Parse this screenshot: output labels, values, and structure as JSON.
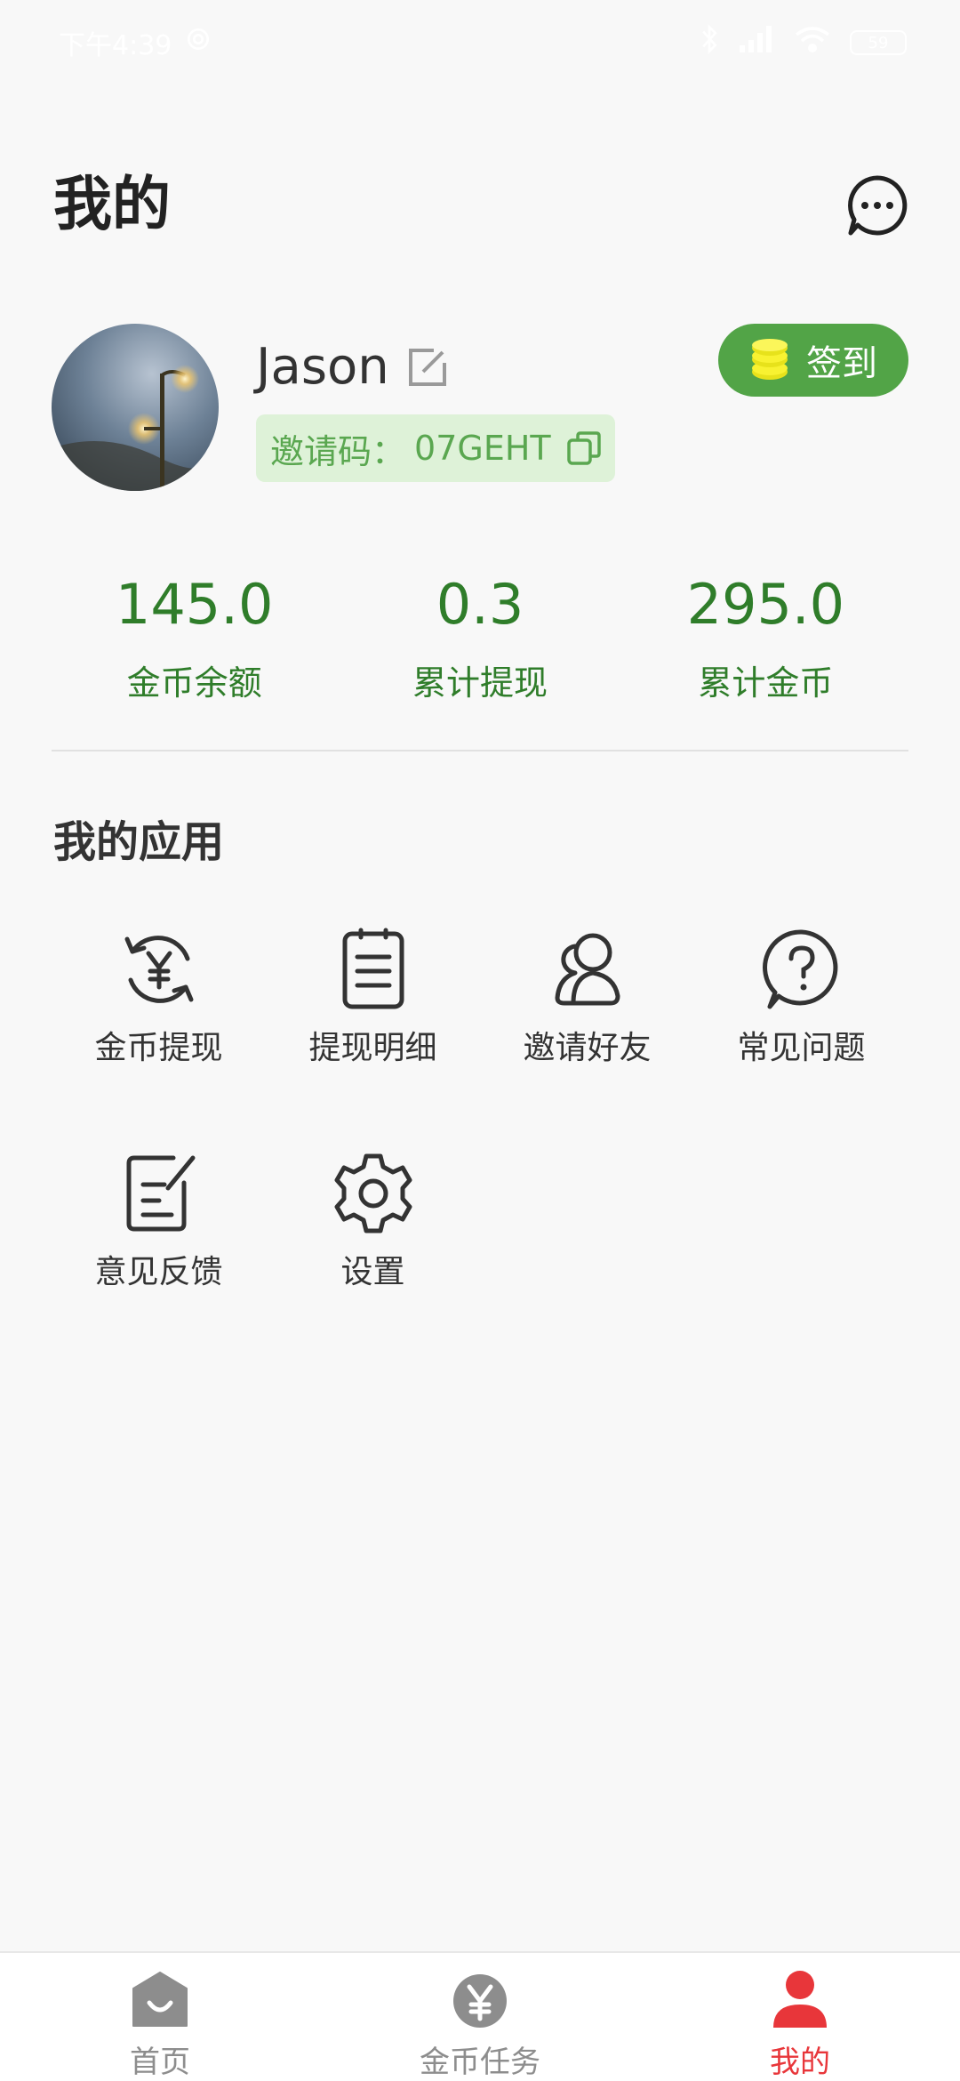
{
  "status_bar": {
    "time": "下午4:39",
    "battery": "59",
    "icons": [
      "settings-gear-icon",
      "bluetooth-icon",
      "signal-icon",
      "wifi-icon",
      "battery-icon"
    ]
  },
  "header": {
    "title": "我的",
    "chat_icon": "chat-bubble-icon"
  },
  "profile": {
    "username": "Jason",
    "invite_label": "邀请码：",
    "invite_code": "07GEHT",
    "sign_in_label": "签到"
  },
  "stats": [
    {
      "value": "145.0",
      "label": "金币余额"
    },
    {
      "value": "0.3",
      "label": "累计提现"
    },
    {
      "value": "295.0",
      "label": "累计金币"
    }
  ],
  "apps": {
    "title": "我的应用",
    "items": [
      {
        "label": "金币提现",
        "icon": "yen-exchange-icon"
      },
      {
        "label": "提现明细",
        "icon": "list-document-icon"
      },
      {
        "label": "邀请好友",
        "icon": "invite-friends-icon"
      },
      {
        "label": "常见问题",
        "icon": "question-icon"
      },
      {
        "label": "意见反馈",
        "icon": "feedback-edit-icon"
      },
      {
        "label": "设置",
        "icon": "settings-icon"
      }
    ]
  },
  "bottom_nav": [
    {
      "label": "首页",
      "icon": "home-icon",
      "active": false
    },
    {
      "label": "金币任务",
      "icon": "coin-task-icon",
      "active": false
    },
    {
      "label": "我的",
      "icon": "profile-icon",
      "active": true
    }
  ],
  "colors": {
    "accent_green": "#52a447",
    "stat_green": "#2f7d2a",
    "invite_bg": "#def2d8",
    "active_red": "#e8363a"
  }
}
